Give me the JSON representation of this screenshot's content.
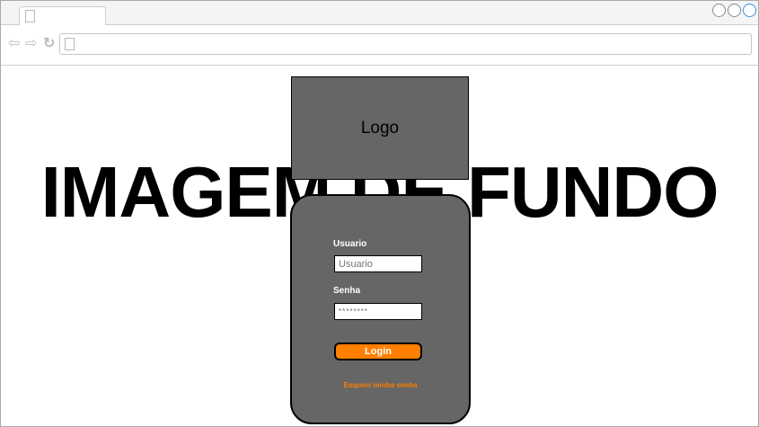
{
  "browser": {
    "nav_back": "⇦",
    "nav_forward": "⇨",
    "nav_reload": "↻",
    "address": ""
  },
  "page": {
    "background_text": "IMAGEM DE FUNDO",
    "logo_text": "Logo",
    "login": {
      "user_label": "Usuario",
      "user_placeholder": "Usuario",
      "pass_label": "Senha",
      "pass_value": "********",
      "button_label": "Login",
      "forgot_link": "Esqueci minha senha"
    }
  },
  "colors": {
    "panel": "#666666",
    "accent": "#ff7f00"
  }
}
